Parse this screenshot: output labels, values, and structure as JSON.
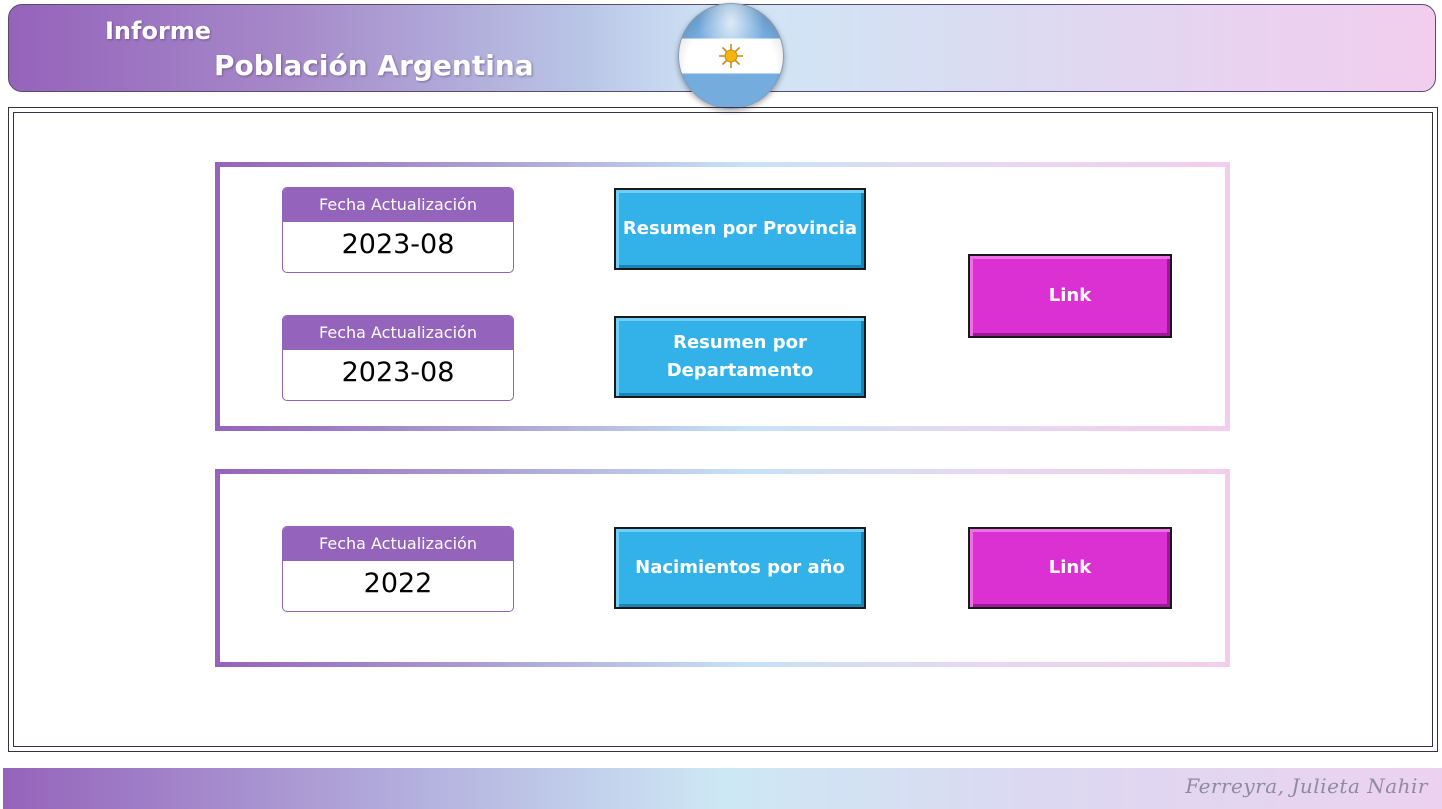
{
  "header": {
    "subtitle": "Informe",
    "title": "Población Argentina",
    "flag_icon": "argentina-flag-icon"
  },
  "section1": {
    "cards": [
      {
        "label": "Fecha Actualización",
        "value": "2023-08"
      },
      {
        "label": "Fecha Actualización",
        "value": "2023-08"
      }
    ],
    "buttons": [
      {
        "label": "Resumen por Provincia"
      },
      {
        "label": "Resumen por Departamento"
      }
    ],
    "link_label": "Link"
  },
  "section2": {
    "card": {
      "label": "Fecha Actualización",
      "value": "2022"
    },
    "button": {
      "label": "Nacimientos por año"
    },
    "link_label": "Link"
  },
  "footer": {
    "signature": "Ferreyra, Julieta Nahir"
  },
  "colors": {
    "purple": "#9464bc",
    "button_blue": "#33b2ea",
    "button_pink": "#dc31d2",
    "gradient_pink": "#f2cdee"
  }
}
